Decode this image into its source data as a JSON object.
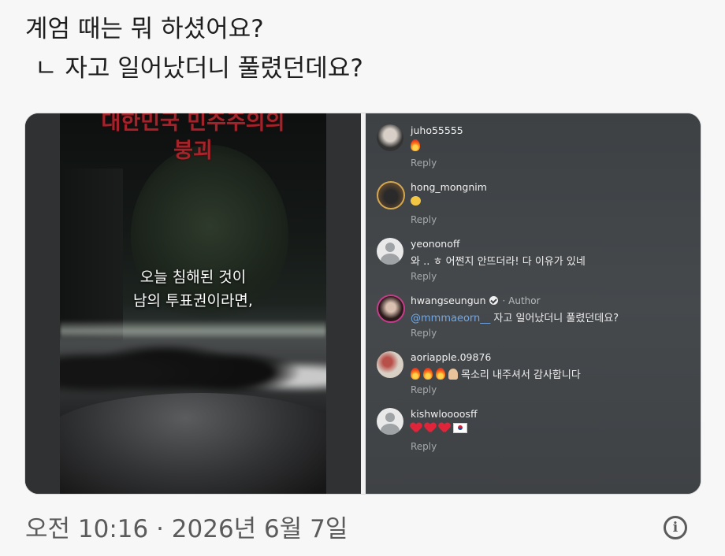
{
  "post": {
    "line1": "계엄 때는 뭐 하셨어요?",
    "line2": "ㄴ 자고 일어났더니 풀렸던데요?"
  },
  "video": {
    "title": "대한민국 민주주의의 붕괴",
    "title_line1": "대한민국 민주주의의",
    "title_line2": "붕괴",
    "subtitle_line1": "오늘 침해된 것이",
    "subtitle_line2": "남의 투표권이라면,"
  },
  "comments": [
    {
      "user": "juho55555",
      "text": "",
      "emoji": [
        "fire"
      ],
      "reply": "Reply"
    },
    {
      "user": "hong_mongnim",
      "text": "",
      "emoji": [
        "clap"
      ],
      "reply": "Reply"
    },
    {
      "user": "yeononoff",
      "text": "와 .. ㅎ 어쩐지 안뜨더라! 다 이유가 있네",
      "emoji": [],
      "reply": "Reply"
    },
    {
      "user": "hwangseungun",
      "author_tag": "· Author",
      "mention": "@mmmaeorn__",
      "text": " 자고 일어났더니 풀렸던데요?",
      "emoji": [],
      "reply": "Reply"
    },
    {
      "user": "aoriapple.09876",
      "text": "목소리 내주셔서 감사합니다",
      "emoji": [
        "fire",
        "fire",
        "fire",
        "folded-hands"
      ],
      "reply": "Reply"
    },
    {
      "user": "kishwloooosff",
      "text": "",
      "emoji": [
        "heart",
        "heart",
        "heart",
        "kr-flag"
      ],
      "reply": "Reply"
    }
  ],
  "footer": {
    "timestamp": "오전 10:16 · 2026년 6월 7일",
    "info_icon": "info-icon"
  }
}
